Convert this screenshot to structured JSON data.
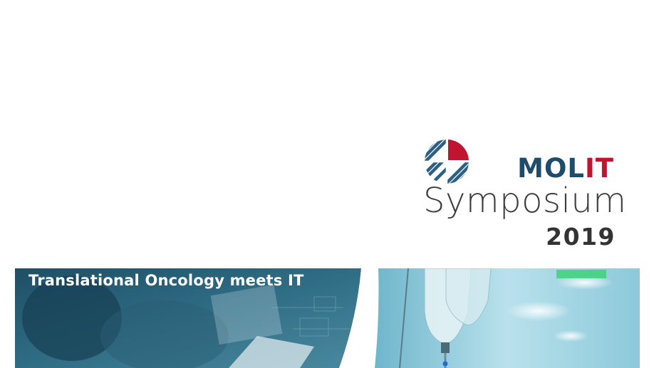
{
  "logo": {
    "brand_prefix": "MOL",
    "brand_suffix": "IT",
    "event_name": "Symposium",
    "year": "2019",
    "colors": {
      "navy": "#1e4d6b",
      "red": "#c0152f",
      "gray": "#3e3e3e"
    },
    "icon": "molit-globe-logo-icon"
  },
  "banner": {
    "tagline": "Translational Oncology meets IT",
    "left_image": "doctor-with-laptop-photo",
    "right_image": "iv-drip-hospital-corridor-photo"
  }
}
